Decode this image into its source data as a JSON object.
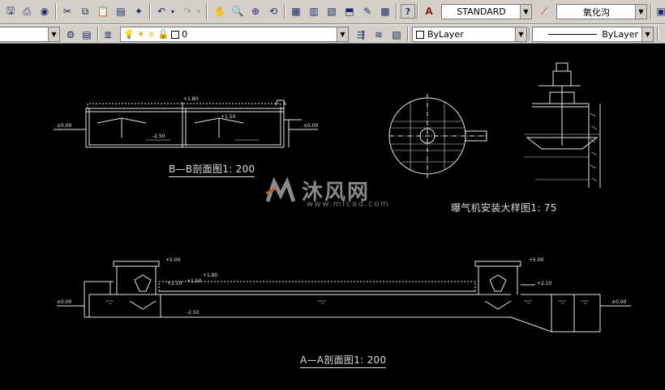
{
  "toolbar": {
    "text_style": "STANDARD",
    "dim_style": "氧化沟",
    "layer_name": "0",
    "color": "ByLayer",
    "linetype": "ByLayer"
  },
  "drawing": {
    "caption_bb": "B—B剖面图1: 200",
    "caption_detail": "曝气机安装大样图1: 75",
    "caption_aa": "A—A剖面图1: 200",
    "watermark_text": "沐风网",
    "watermark_url": "www.mfcad.com",
    "elev_labels": {
      "bb_left": "±0.00",
      "bb_top": "+1.80",
      "bb_mid": "+1.50",
      "bb_water": "-2.50",
      "bb_right": "±0.00",
      "aa_top_left": "+5.00",
      "aa_top_right": "+5.00",
      "aa_a": "+1.50",
      "aa_b": "+1.80",
      "aa_c": "+2.10",
      "aa_d": "+2.10",
      "aa_left": "±0.00",
      "aa_right": "±0.00",
      "aa_bottom": "-2.50"
    }
  },
  "colors": {
    "toolbar_bg": "#d4d0c8",
    "canvas_bg": "#000000",
    "line": "#e8e8e8"
  }
}
